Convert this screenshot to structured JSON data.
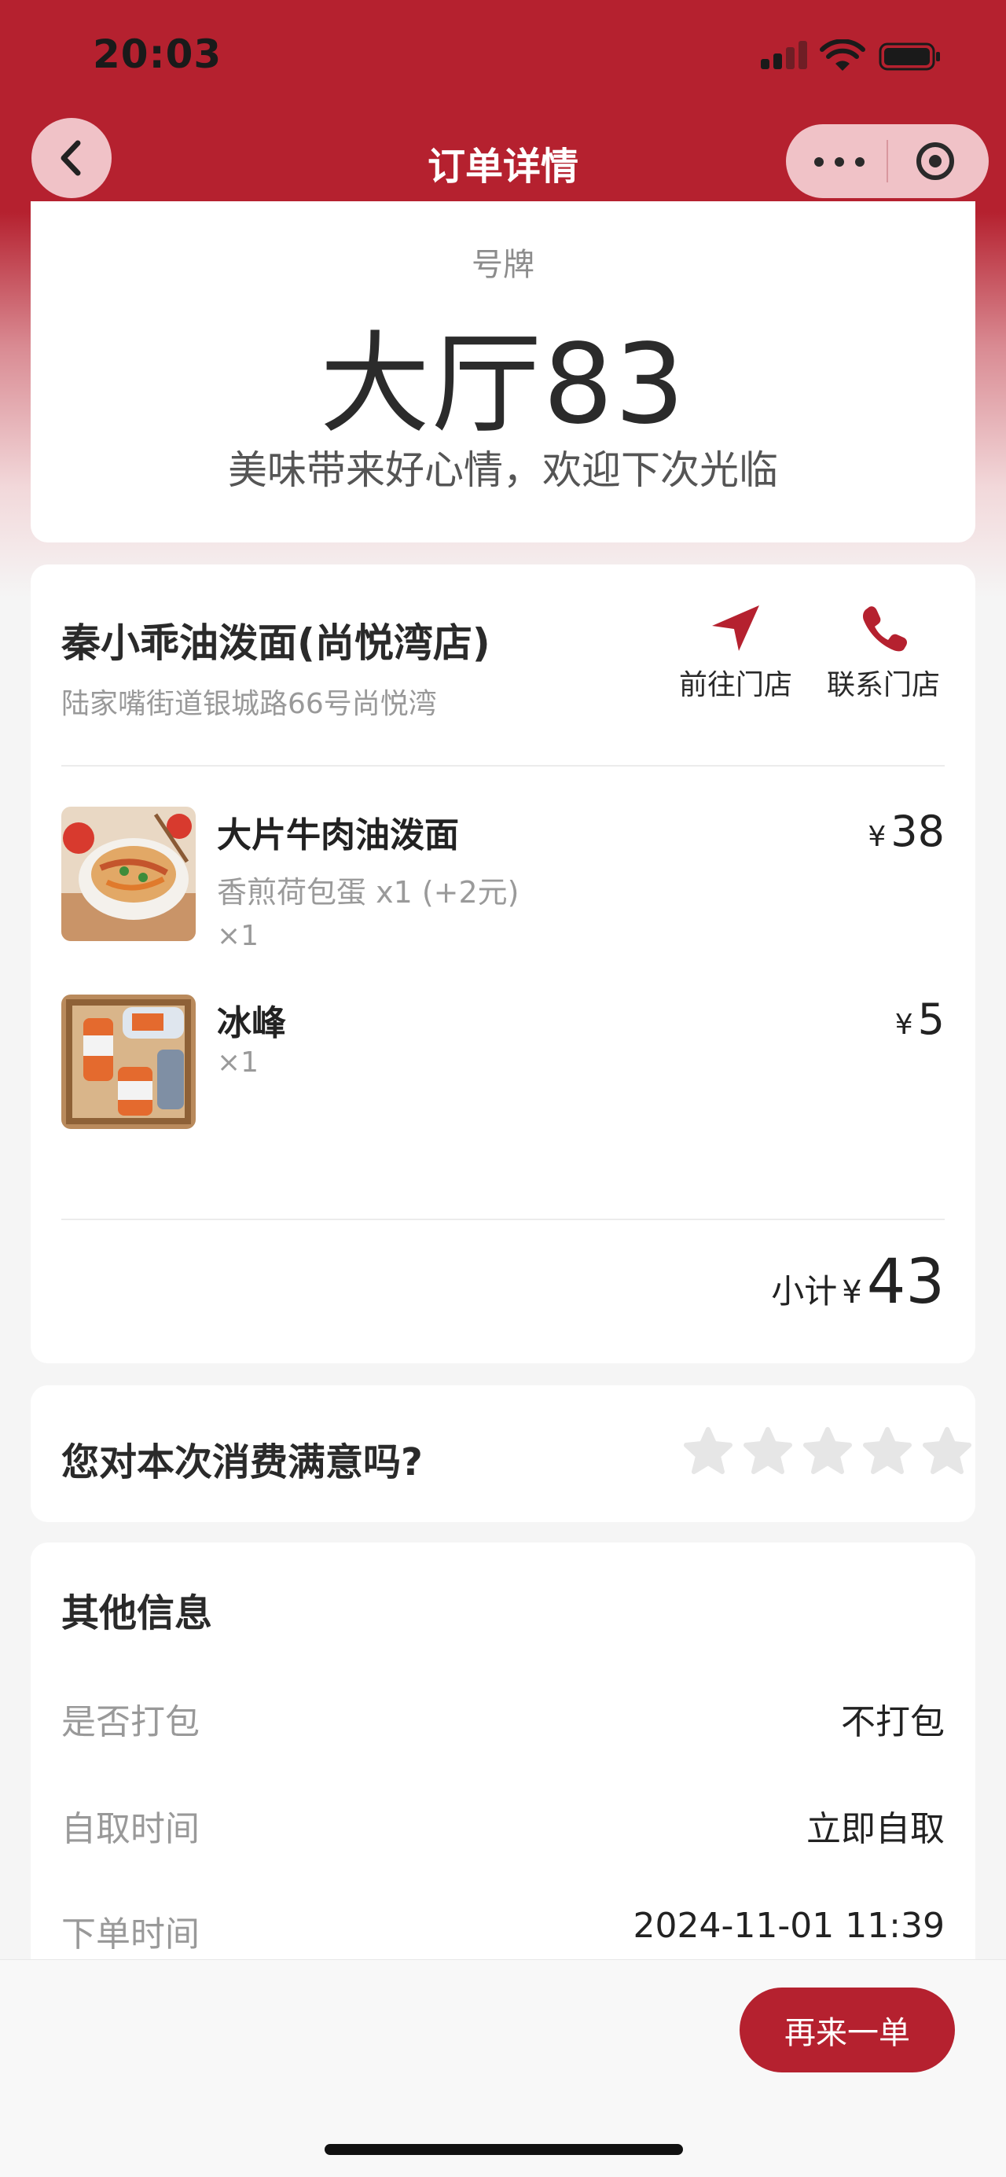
{
  "status_bar": {
    "time": "20:03"
  },
  "nav": {
    "title": "订单详情"
  },
  "ticket": {
    "label": "号牌",
    "number": "大厅83",
    "message": "美味带来好心情，欢迎下次光临"
  },
  "store": {
    "name": "秦小乖油泼面(尚悦湾店)",
    "address": "陆家嘴街道银城路66号尚悦湾",
    "actions": [
      {
        "label": "前往门店",
        "icon": "navigation-arrow-icon"
      },
      {
        "label": "联系门店",
        "icon": "phone-icon"
      }
    ]
  },
  "items": [
    {
      "name": "大片牛肉油泼面",
      "spec": "香煎荷包蛋 x1 (+2元)",
      "qty": "×1",
      "currency": "¥",
      "price": "38"
    },
    {
      "name": "冰峰",
      "spec": "",
      "qty": "×1",
      "currency": "¥",
      "price": "5"
    }
  ],
  "subtotal": {
    "label": "小计",
    "currency": "¥",
    "amount": "43"
  },
  "rating": {
    "question": "您对本次消费满意吗?",
    "stars": 5,
    "selected": 0
  },
  "info": {
    "title": "其他信息",
    "rows": [
      {
        "label": "是否打包",
        "value": "不打包"
      },
      {
        "label": "自取时间",
        "value": "立即自取"
      },
      {
        "label": "下单时间",
        "value": "2024-11-01 11:39"
      }
    ]
  },
  "footer": {
    "reorder_label": "再来一单"
  },
  "colors": {
    "brand": "#b5212f",
    "star_empty": "#e6e6e6"
  }
}
